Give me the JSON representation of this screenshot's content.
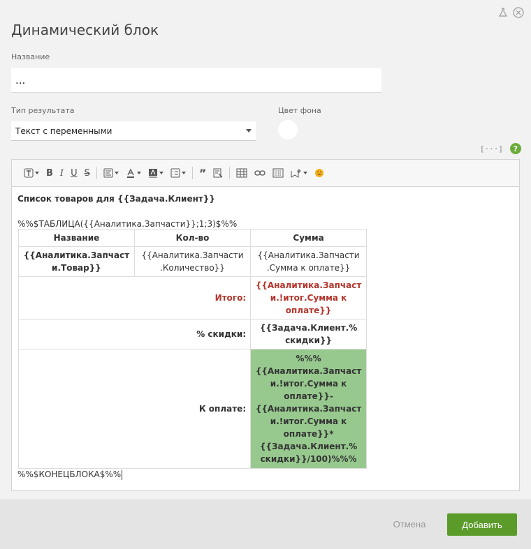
{
  "dialog": {
    "title": "Динамический блок",
    "name_label": "Название",
    "name_value": "...",
    "result_type_label": "Тип результата",
    "result_type_value": "Текст с переменными",
    "bg_color_label": "Цвет фона",
    "bg_color_value": "#ffffff",
    "help_icon_text": "?"
  },
  "icons": {
    "top": [
      "flask-icon",
      "close-icon"
    ],
    "aux": [
      "brackets-icon",
      "help-icon"
    ],
    "toolbar": [
      "text-style-icon",
      "bold-icon",
      "italic-icon",
      "underline-icon",
      "strikethrough-icon",
      "paragraph-icon",
      "font-color-icon",
      "background-color-icon",
      "list-icon",
      "quote-icon",
      "clear-format-icon",
      "table-icon",
      "link-icon",
      "image-icon",
      "insert-icon",
      "emoji-icon"
    ]
  },
  "editor": {
    "line1": "Список товаров для {{Задача.Клиент}}",
    "line2": "%%$ТАБЛИЦА({{Аналитика.Запчасти}};1;3)$%%",
    "table": {
      "headers": [
        "Название",
        "Кол-во",
        "Сумма"
      ],
      "row1": [
        "{{Аналитика.Запчаст и.Товар}}",
        "{{Аналитика.Запчасти .Количество}}",
        "{{Аналитика.Запчасти .Сумма к оплате}}"
      ],
      "total_label": "Итого:",
      "total_value": "{{Аналитика.Запчаст и.!итог.Сумма к оплате}}",
      "discount_label": "% скидки:",
      "discount_value": "{{Задача.Клиент.% скидки}}",
      "pay_label": "К оплате:",
      "pay_value": "%%% {{Аналитика.Запчаст и.!итог.Сумма к оплате}}- {{Аналитика.Запчаст и.!итог.Сумма к оплате}}* {{Задача.Клиент.% скидки}}/100)%%%"
    },
    "line_end": "%%$КОНЕЦБЛОКА$%%"
  },
  "footer": {
    "cancel_label": "Отмена",
    "add_label": "Добавить"
  },
  "colors": {
    "accent_green": "#5b9b2a",
    "highlight_green": "#97c98e",
    "total_red": "#b3352b"
  }
}
